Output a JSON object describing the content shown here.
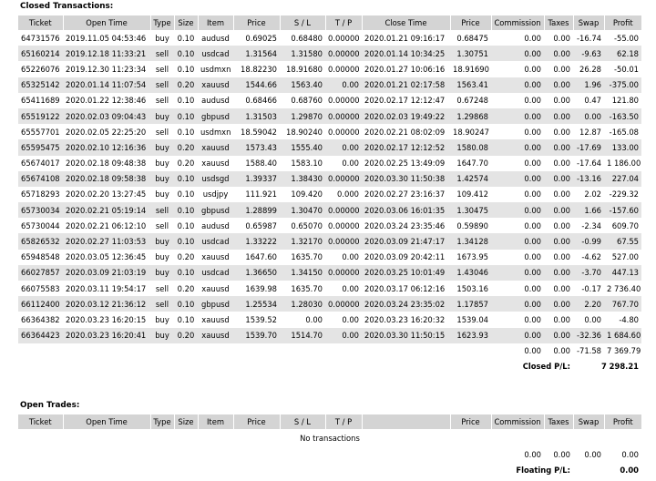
{
  "closed": {
    "title": "Closed Transactions:",
    "headers": [
      "Ticket",
      "Open Time",
      "Type",
      "Size",
      "Item",
      "Price",
      "S / L",
      "T / P",
      "Close Time",
      "Price",
      "Commission",
      "Taxes",
      "Swap",
      "Profit"
    ],
    "rows": [
      [
        "64731576",
        "2019.11.05 04:53:46",
        "buy",
        "0.10",
        "audusd",
        "0.69025",
        "0.68480",
        "0.00000",
        "2020.01.21 09:16:17",
        "0.68475",
        "0.00",
        "0.00",
        "-16.74",
        "-55.00"
      ],
      [
        "65160214",
        "2019.12.18 11:33:21",
        "sell",
        "0.10",
        "usdcad",
        "1.31564",
        "1.31580",
        "0.00000",
        "2020.01.14 10:34:25",
        "1.30751",
        "0.00",
        "0.00",
        "-9.63",
        "62.18"
      ],
      [
        "65226076",
        "2019.12.30 11:23:34",
        "sell",
        "0.10",
        "usdmxn",
        "18.82230",
        "18.91680",
        "0.00000",
        "2020.01.27 10:06:16",
        "18.91690",
        "0.00",
        "0.00",
        "26.28",
        "-50.01"
      ],
      [
        "65325142",
        "2020.01.14 11:07:54",
        "sell",
        "0.20",
        "xauusd",
        "1544.66",
        "1563.40",
        "0.00",
        "2020.01.21 02:17:58",
        "1563.41",
        "0.00",
        "0.00",
        "1.96",
        "-375.00"
      ],
      [
        "65411689",
        "2020.01.22 12:38:46",
        "sell",
        "0.10",
        "audusd",
        "0.68466",
        "0.68760",
        "0.00000",
        "2020.02.17 12:12:47",
        "0.67248",
        "0.00",
        "0.00",
        "0.47",
        "121.80"
      ],
      [
        "65519122",
        "2020.02.03 09:04:43",
        "buy",
        "0.10",
        "gbpusd",
        "1.31503",
        "1.29870",
        "0.00000",
        "2020.02.03 19:49:22",
        "1.29868",
        "0.00",
        "0.00",
        "0.00",
        "-163.50"
      ],
      [
        "65557701",
        "2020.02.05 22:25:20",
        "sell",
        "0.10",
        "usdmxn",
        "18.59042",
        "18.90240",
        "0.00000",
        "2020.02.21 08:02:09",
        "18.90247",
        "0.00",
        "0.00",
        "12.87",
        "-165.08"
      ],
      [
        "65595475",
        "2020.02.10 12:16:36",
        "buy",
        "0.20",
        "xauusd",
        "1573.43",
        "1555.40",
        "0.00",
        "2020.02.17 12:12:52",
        "1580.08",
        "0.00",
        "0.00",
        "-17.69",
        "133.00"
      ],
      [
        "65674017",
        "2020.02.18 09:48:38",
        "buy",
        "0.20",
        "xauusd",
        "1588.40",
        "1583.10",
        "0.00",
        "2020.02.25 13:49:09",
        "1647.70",
        "0.00",
        "0.00",
        "-17.64",
        "1 186.00"
      ],
      [
        "65674108",
        "2020.02.18 09:58:38",
        "buy",
        "0.10",
        "usdsgd",
        "1.39337",
        "1.38430",
        "0.00000",
        "2020.03.30 11:50:38",
        "1.42574",
        "0.00",
        "0.00",
        "-13.16",
        "227.04"
      ],
      [
        "65718293",
        "2020.02.20 13:27:45",
        "buy",
        "0.10",
        "usdjpy",
        "111.921",
        "109.420",
        "0.000",
        "2020.02.27 23:16:37",
        "109.412",
        "0.00",
        "0.00",
        "2.02",
        "-229.32"
      ],
      [
        "65730034",
        "2020.02.21 05:19:14",
        "sell",
        "0.10",
        "gbpusd",
        "1.28899",
        "1.30470",
        "0.00000",
        "2020.03.06 16:01:35",
        "1.30475",
        "0.00",
        "0.00",
        "1.66",
        "-157.60"
      ],
      [
        "65730044",
        "2020.02.21 06:12:10",
        "sell",
        "0.10",
        "audusd",
        "0.65987",
        "0.65070",
        "0.00000",
        "2020.03.24 23:35:46",
        "0.59890",
        "0.00",
        "0.00",
        "-2.34",
        "609.70"
      ],
      [
        "65826532",
        "2020.02.27 11:03:53",
        "buy",
        "0.10",
        "usdcad",
        "1.33222",
        "1.32170",
        "0.00000",
        "2020.03.09 21:47:17",
        "1.34128",
        "0.00",
        "0.00",
        "-0.99",
        "67.55"
      ],
      [
        "65948548",
        "2020.03.05 12:36:45",
        "buy",
        "0.20",
        "xauusd",
        "1647.60",
        "1635.70",
        "0.00",
        "2020.03.09 20:42:11",
        "1673.95",
        "0.00",
        "0.00",
        "-4.62",
        "527.00"
      ],
      [
        "66027857",
        "2020.03.09 21:03:19",
        "buy",
        "0.10",
        "usdcad",
        "1.36650",
        "1.34150",
        "0.00000",
        "2020.03.25 10:01:49",
        "1.43046",
        "0.00",
        "0.00",
        "-3.70",
        "447.13"
      ],
      [
        "66075583",
        "2020.03.11 19:54:17",
        "sell",
        "0.20",
        "xauusd",
        "1639.98",
        "1635.70",
        "0.00",
        "2020.03.17 06:12:16",
        "1503.16",
        "0.00",
        "0.00",
        "-0.17",
        "2 736.40"
      ],
      [
        "66112400",
        "2020.03.12 21:36:12",
        "sell",
        "0.10",
        "gbpusd",
        "1.25534",
        "1.28030",
        "0.00000",
        "2020.03.24 23:35:02",
        "1.17857",
        "0.00",
        "0.00",
        "2.20",
        "767.70"
      ],
      [
        "66364382",
        "2020.03.23 16:20:15",
        "buy",
        "0.10",
        "xauusd",
        "1539.52",
        "0.00",
        "0.00",
        "2020.03.23 16:20:32",
        "1539.04",
        "0.00",
        "0.00",
        "0.00",
        "-4.80"
      ],
      [
        "66364423",
        "2020.03.23 16:20:41",
        "buy",
        "0.20",
        "xauusd",
        "1539.70",
        "1514.70",
        "0.00",
        "2020.03.30 11:50:15",
        "1623.93",
        "0.00",
        "0.00",
        "-32.36",
        "1 684.60"
      ]
    ],
    "totals": {
      "commission": "0.00",
      "taxes": "0.00",
      "swap": "-71.58",
      "profit": "7 369.79"
    },
    "summary_label": "Closed P/L:",
    "summary_value": "7 298.21"
  },
  "open": {
    "title": "Open Trades:",
    "headers": [
      "Ticket",
      "Open Time",
      "Type",
      "Size",
      "Item",
      "Price",
      "S / L",
      "T / P",
      "",
      "Price",
      "Commission",
      "Taxes",
      "Swap",
      "Profit"
    ],
    "empty_text": "No transactions",
    "totals": {
      "commission": "0.00",
      "taxes": "0.00",
      "swap": "0.00",
      "profit": "0.00"
    },
    "summary_label": "Floating P/L:",
    "summary_value": "0.00"
  }
}
